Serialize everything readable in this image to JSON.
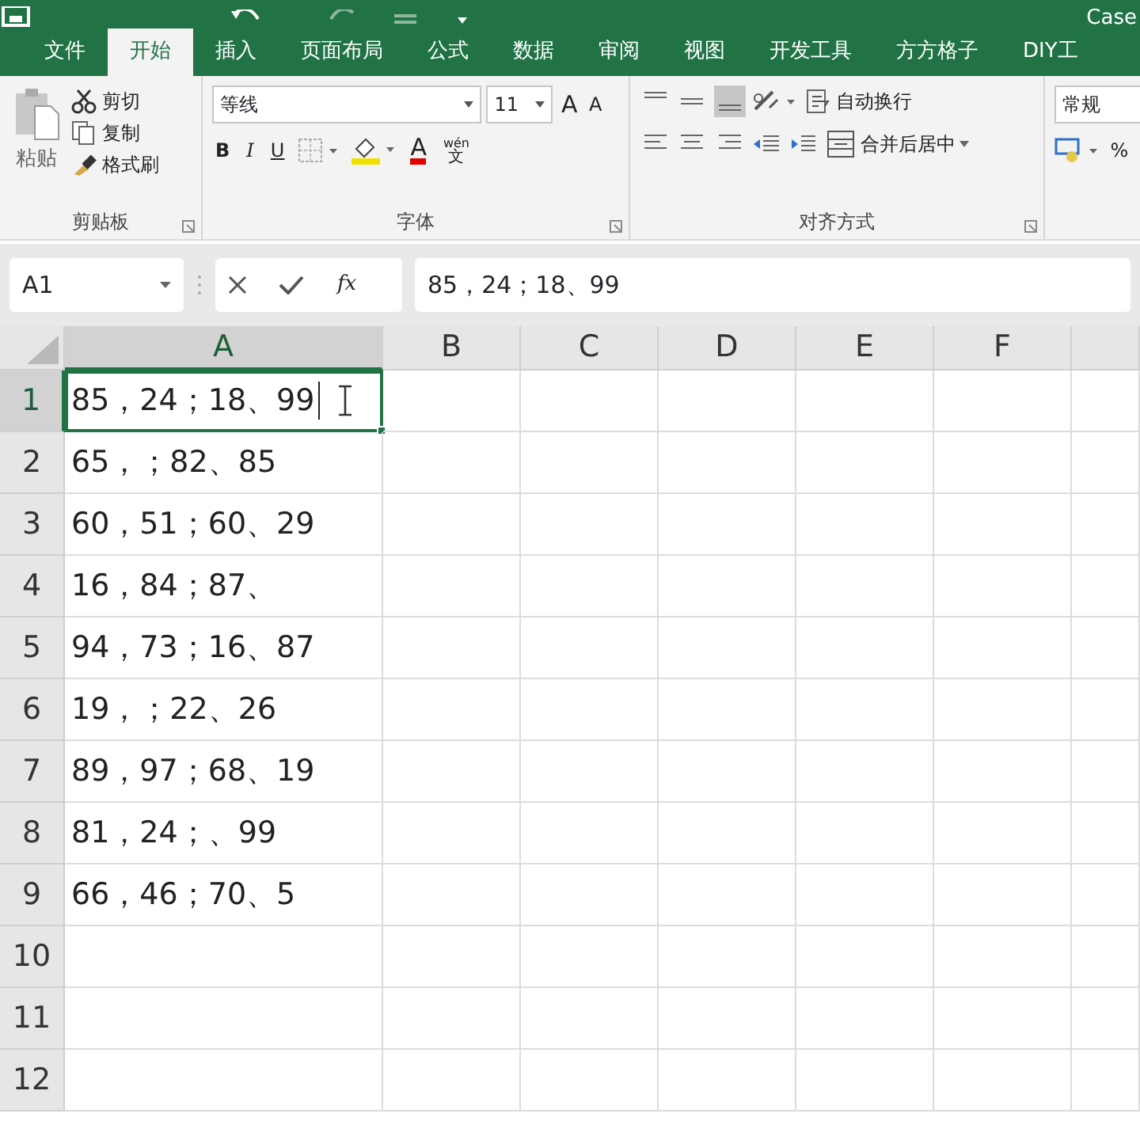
{
  "title_bar": {
    "title": "Case"
  },
  "tabs": [
    {
      "label": "文件",
      "selected": false
    },
    {
      "label": "开始",
      "selected": true
    },
    {
      "label": "插入",
      "selected": false
    },
    {
      "label": "页面布局",
      "selected": false
    },
    {
      "label": "公式",
      "selected": false
    },
    {
      "label": "数据",
      "selected": false
    },
    {
      "label": "审阅",
      "selected": false
    },
    {
      "label": "视图",
      "selected": false
    },
    {
      "label": "开发工具",
      "selected": false
    },
    {
      "label": "方方格子",
      "selected": false
    },
    {
      "label": "DIY工",
      "selected": false
    }
  ],
  "ribbon": {
    "clipboard": {
      "paste": "粘贴",
      "cut": "剪切",
      "copy": "复制",
      "format_painter": "格式刷",
      "label": "剪贴板"
    },
    "font": {
      "font_name": "等线",
      "font_size": "11",
      "grow": "A",
      "shrink": "A",
      "bold": "B",
      "italic": "I",
      "underline": "U",
      "font_color": "A",
      "phonetic_top": "wén",
      "phonetic_bottom": "文",
      "label": "字体"
    },
    "alignment": {
      "wrap_text": "自动换行",
      "merge_center": "合并后居中",
      "label": "对齐方式"
    },
    "number": {
      "format": "常规",
      "percent": "%"
    }
  },
  "formula_bar": {
    "name_box": "A1",
    "fx": "fx",
    "formula": "85，24；18、99"
  },
  "sheet": {
    "columns": [
      {
        "label": "A",
        "selected": true
      },
      {
        "label": "B",
        "selected": false
      },
      {
        "label": "C",
        "selected": false
      },
      {
        "label": "D",
        "selected": false
      },
      {
        "label": "E",
        "selected": false
      },
      {
        "label": "F",
        "selected": false
      }
    ],
    "rows": [
      {
        "number": "1",
        "selected": true,
        "a": "85，24；18、99"
      },
      {
        "number": "2",
        "selected": false,
        "a": "65，；82、85"
      },
      {
        "number": "3",
        "selected": false,
        "a": "60，51；60、29"
      },
      {
        "number": "4",
        "selected": false,
        "a": "16，84；87、"
      },
      {
        "number": "5",
        "selected": false,
        "a": "94，73；16、87"
      },
      {
        "number": "6",
        "selected": false,
        "a": "19，；22、26"
      },
      {
        "number": "7",
        "selected": false,
        "a": "89，97；68、19"
      },
      {
        "number": "8",
        "selected": false,
        "a": "81，24；、99"
      },
      {
        "number": "9",
        "selected": false,
        "a": "66，46；70、5"
      },
      {
        "number": "10",
        "selected": false,
        "a": ""
      },
      {
        "number": "11",
        "selected": false,
        "a": ""
      },
      {
        "number": "12",
        "selected": false,
        "a": ""
      }
    ],
    "editing": true
  }
}
